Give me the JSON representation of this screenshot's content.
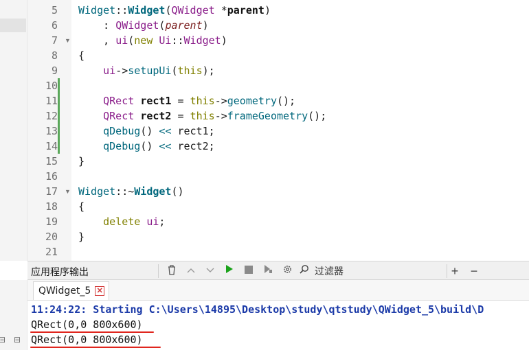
{
  "editor": {
    "lines": [
      {
        "n": "5",
        "tokens": [
          [
            "k-fn",
            "Widget"
          ],
          [
            "k-op",
            "::"
          ],
          [
            "k-bold",
            "Widget"
          ],
          [
            "k-op",
            "("
          ],
          [
            "k-type",
            "QWidget "
          ],
          [
            "k-op",
            "*"
          ],
          [
            "k-var",
            "parent"
          ],
          [
            "k-op",
            ")"
          ]
        ]
      },
      {
        "n": "6",
        "tokens": [
          [
            "k-op",
            "    : "
          ],
          [
            "k-type",
            "QWidget"
          ],
          [
            "k-op",
            "("
          ],
          [
            "k-param",
            "parent"
          ],
          [
            "k-op",
            ")"
          ]
        ]
      },
      {
        "n": "7",
        "tokens": [
          [
            "k-op",
            "    , "
          ],
          [
            "k-type",
            "ui"
          ],
          [
            "k-op",
            "("
          ],
          [
            "k-kw",
            "new "
          ],
          [
            "k-type",
            "Ui"
          ],
          [
            "k-op",
            "::"
          ],
          [
            "k-type",
            "Widget"
          ],
          [
            "k-op",
            ")"
          ]
        ]
      },
      {
        "n": "8",
        "tokens": [
          [
            "k-op",
            "{"
          ]
        ]
      },
      {
        "n": "9",
        "tokens": [
          [
            "k-op",
            "    "
          ],
          [
            "k-type",
            "ui"
          ],
          [
            "k-op",
            "->"
          ],
          [
            "k-fn",
            "setupUi"
          ],
          [
            "k-op",
            "("
          ],
          [
            "k-kw",
            "this"
          ],
          [
            "k-op",
            ");"
          ]
        ]
      },
      {
        "n": "10",
        "tokens": []
      },
      {
        "n": "11",
        "tokens": [
          [
            "k-op",
            "    "
          ],
          [
            "k-type",
            "QRect "
          ],
          [
            "k-var",
            "rect1"
          ],
          [
            "k-op",
            " = "
          ],
          [
            "k-kw",
            "this"
          ],
          [
            "k-op",
            "->"
          ],
          [
            "k-fn",
            "geometry"
          ],
          [
            "k-op",
            "();"
          ]
        ]
      },
      {
        "n": "12",
        "tokens": [
          [
            "k-op",
            "    "
          ],
          [
            "k-type",
            "QRect "
          ],
          [
            "k-var",
            "rect2"
          ],
          [
            "k-op",
            " = "
          ],
          [
            "k-kw",
            "this"
          ],
          [
            "k-op",
            "->"
          ],
          [
            "k-fn",
            "frameGeometry"
          ],
          [
            "k-op",
            "();"
          ]
        ]
      },
      {
        "n": "13",
        "tokens": [
          [
            "k-op",
            "    "
          ],
          [
            "k-fn",
            "qDebug"
          ],
          [
            "k-op",
            "() "
          ],
          [
            "k-fn",
            "<<"
          ],
          [
            "k-op",
            " rect1;"
          ]
        ]
      },
      {
        "n": "14",
        "tokens": [
          [
            "k-op",
            "    "
          ],
          [
            "k-fn",
            "qDebug"
          ],
          [
            "k-op",
            "() "
          ],
          [
            "k-fn",
            "<<"
          ],
          [
            "k-op",
            " rect2;"
          ]
        ]
      },
      {
        "n": "15",
        "tokens": [
          [
            "k-op",
            "}"
          ]
        ]
      },
      {
        "n": "16",
        "tokens": []
      },
      {
        "n": "17",
        "tokens": [
          [
            "k-fn",
            "Widget"
          ],
          [
            "k-op",
            "::~"
          ],
          [
            "k-bold",
            "Widget"
          ],
          [
            "k-op",
            "()"
          ]
        ]
      },
      {
        "n": "18",
        "tokens": [
          [
            "k-op",
            "{"
          ]
        ]
      },
      {
        "n": "19",
        "tokens": [
          [
            "k-op",
            "    "
          ],
          [
            "k-kw",
            "delete "
          ],
          [
            "k-type",
            "ui"
          ],
          [
            "k-op",
            ";"
          ]
        ]
      },
      {
        "n": "20",
        "tokens": [
          [
            "k-op",
            "}"
          ]
        ]
      },
      {
        "n": "21",
        "tokens": []
      }
    ],
    "fold_lines": [
      "7",
      "17"
    ]
  },
  "output_pane": {
    "title": "应用程序输出",
    "filter_label": "过滤器",
    "toolbar": {
      "clear_icon": "trash-icon",
      "up_icon": "arrow-up-icon",
      "down_icon": "arrow-down-icon",
      "run_icon": "play-icon",
      "stop_icon": "stop-icon",
      "debug_icon": "debug-icon",
      "settings_icon": "gear-icon",
      "search_icon": "search-icon",
      "add_icon": "plus-icon",
      "minimize_icon": "minus-icon"
    },
    "tab_label": "QWidget_5",
    "lines": [
      {
        "text": "11:24:22: Starting C:\\Users\\14895\\Desktop\\study\\qtstudy\\QWidget_5\\build\\D",
        "style": "ok"
      },
      {
        "text": "QRect(0,0 800x600)",
        "style": "plain"
      },
      {
        "text": "QRect(0,0 800x600)",
        "style": "plain"
      }
    ]
  },
  "colors": {
    "highlight_underline": "#e0261e",
    "change_bar": "#5aa85a",
    "play": "#1aa21a"
  }
}
